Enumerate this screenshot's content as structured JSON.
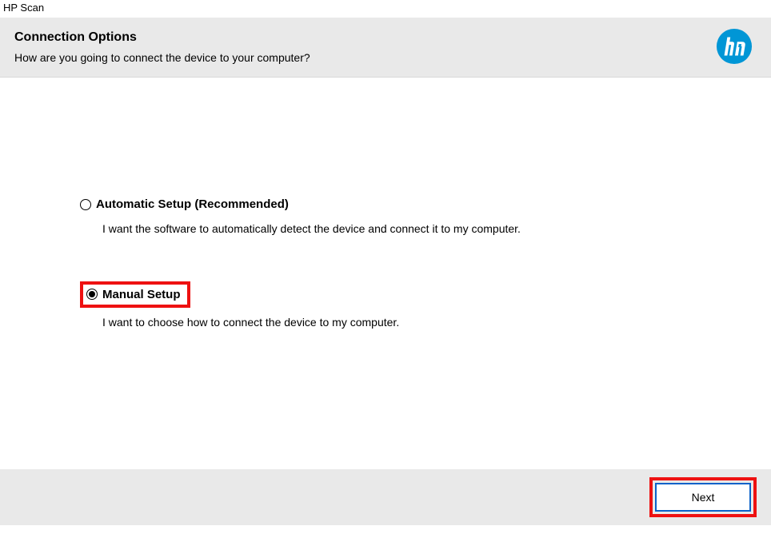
{
  "window": {
    "title": "HP Scan"
  },
  "header": {
    "title": "Connection Options",
    "subtitle": "How are you going to connect the device to your computer?"
  },
  "options": {
    "automatic": {
      "label": "Automatic Setup (Recommended)",
      "description": "I want the software to automatically detect the device and connect it to my computer.",
      "selected": false
    },
    "manual": {
      "label": "Manual Setup",
      "description": "I want to choose how to connect the device to my computer.",
      "selected": true
    }
  },
  "footer": {
    "next_label": "Next"
  },
  "brand": {
    "logo_name": "hp-logo"
  }
}
